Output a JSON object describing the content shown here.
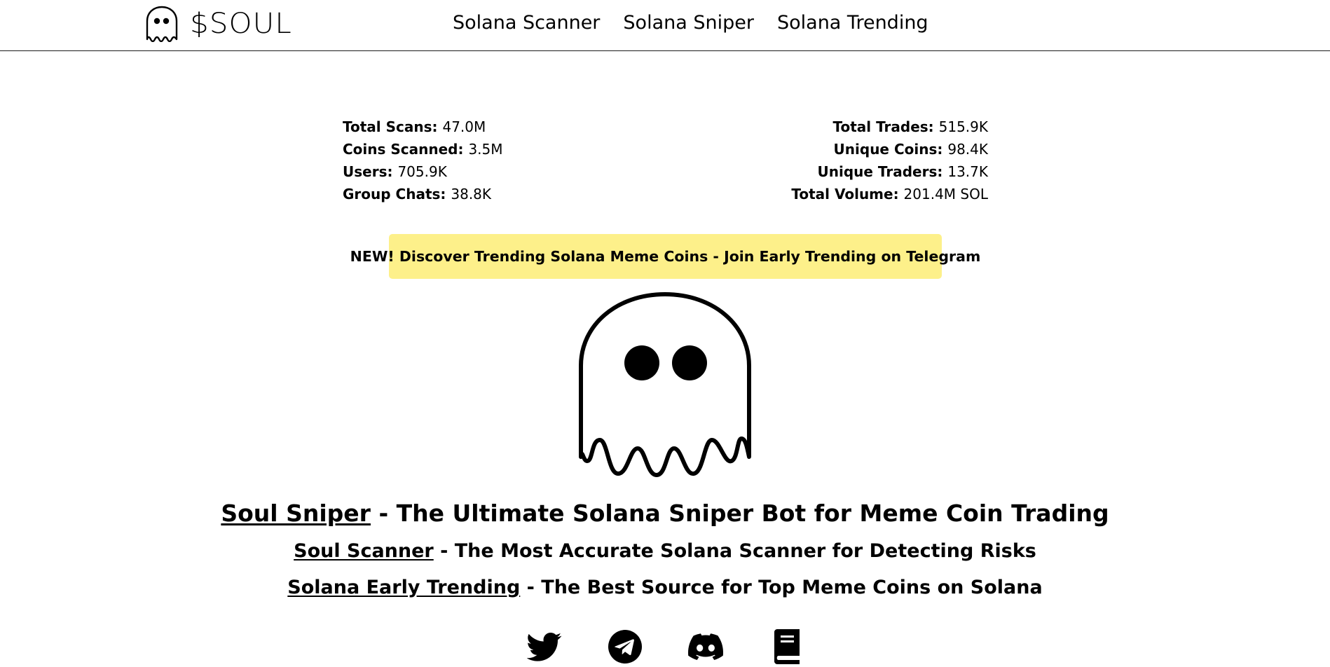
{
  "header": {
    "logo_text": "$SOUL",
    "nav": [
      {
        "label": "Solana Scanner"
      },
      {
        "label": "Solana Sniper"
      },
      {
        "label": "Solana Trending"
      }
    ]
  },
  "stats": {
    "left": [
      {
        "label": "Total Scans:",
        "value": "47.0M"
      },
      {
        "label": "Coins Scanned:",
        "value": "3.5M"
      },
      {
        "label": "Users:",
        "value": "705.9K"
      },
      {
        "label": "Group Chats:",
        "value": "38.8K"
      }
    ],
    "right": [
      {
        "label": "Total Trades:",
        "value": "515.9K"
      },
      {
        "label": "Unique Coins:",
        "value": "98.4K"
      },
      {
        "label": "Unique Traders:",
        "value": "13.7K"
      },
      {
        "label": "Total Volume:",
        "value": "201.4M SOL"
      }
    ]
  },
  "banner": {
    "text": "NEW! Discover Trending Solana Meme Coins - Join Early Trending on Telegram",
    "color": "#fdf08a"
  },
  "taglines": [
    {
      "link": "Soul Sniper",
      "text": " - The Ultimate Solana Sniper Bot for Meme Coin Trading"
    },
    {
      "link": "Soul Scanner",
      "text": " - The Most Accurate Solana Scanner for Detecting Risks"
    },
    {
      "link": "Solana Early Trending",
      "text": " - The Best Source for Top Meme Coins on Solana"
    }
  ],
  "socials": [
    {
      "icon": "twitter-icon"
    },
    {
      "icon": "telegram-icon"
    },
    {
      "icon": "discord-icon"
    },
    {
      "icon": "docs-book-icon"
    }
  ]
}
